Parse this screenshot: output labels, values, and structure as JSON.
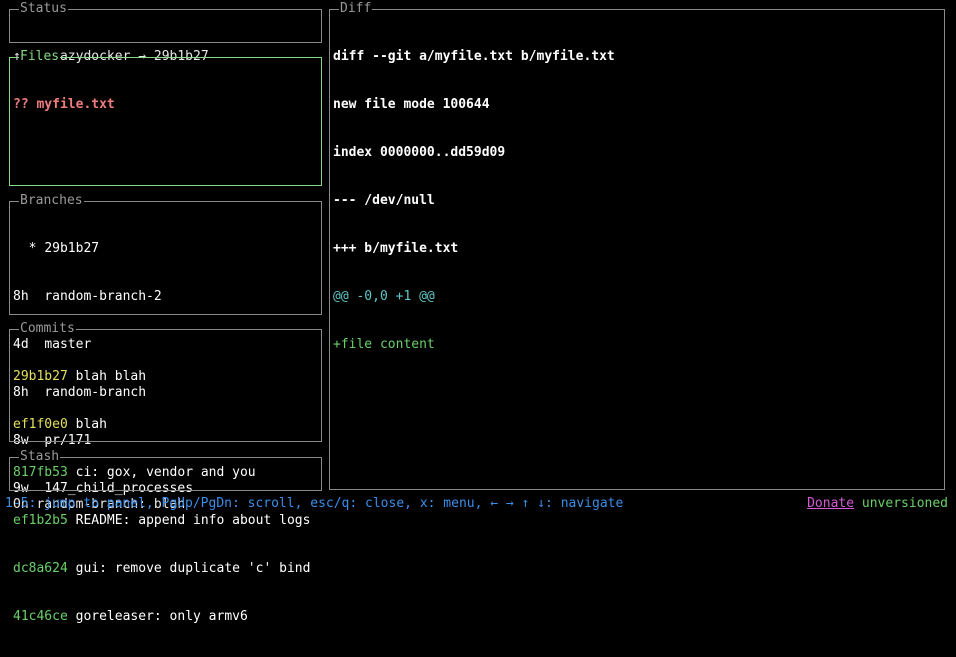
{
  "status": {
    "title": "Status",
    "text": "↑?↓? lazydocker → 29b1b27"
  },
  "files": {
    "title": "Files",
    "items": [
      {
        "text": "?? myfile.txt"
      }
    ]
  },
  "branches": {
    "title": "Branches",
    "items": [
      {
        "recency": "  *",
        "name": "29b1b27"
      },
      {
        "recency": "8h ",
        "name": "random-branch-2"
      },
      {
        "recency": "4d ",
        "name": "master"
      },
      {
        "recency": "8h ",
        "name": "random-branch"
      },
      {
        "recency": "8w ",
        "name": "pr/171"
      },
      {
        "recency": "9w ",
        "name": "147_child_processes"
      }
    ]
  },
  "commits": {
    "title": "Commits",
    "items": [
      {
        "sha": "29b1b27",
        "message": "blah blah",
        "sha_color": "#e5e05c"
      },
      {
        "sha": "ef1f0e0",
        "message": "blah",
        "sha_color": "#e5e05c"
      },
      {
        "sha": "817fb53",
        "message": "ci: gox, vendor and you",
        "sha_color": "#6ad06a"
      },
      {
        "sha": "ef1b2b5",
        "message": "README: append info about logs",
        "sha_color": "#6ad06a"
      },
      {
        "sha": "dc8a624",
        "message": "gui: remove duplicate 'c' bind",
        "sha_color": "#6ad06a"
      },
      {
        "sha": "41c46ce",
        "message": "goreleaser: only armv6",
        "sha_color": "#6ad06a"
      }
    ]
  },
  "stash": {
    "title": "Stash",
    "items": [
      {
        "text": "On random-branch: blah"
      }
    ]
  },
  "diff": {
    "title": "Diff",
    "lines": [
      {
        "text": "diff --git a/myfile.txt b/myfile.txt",
        "kind": "header"
      },
      {
        "text": "new file mode 100644",
        "kind": "header"
      },
      {
        "text": "index 0000000..dd59d09",
        "kind": "header"
      },
      {
        "text": "--- /dev/null",
        "kind": "header"
      },
      {
        "text": "+++ b/myfile.txt",
        "kind": "header"
      },
      {
        "text": "@@ -0,0 +1 @@",
        "kind": "hunk"
      },
      {
        "text": "+file content",
        "kind": "add"
      }
    ]
  },
  "footer": {
    "help": "1-5: jump to panel, PgUp/PgDn: scroll, esc/q: close, x: menu, ← → ↑ ↓: navigate",
    "donate": "Donate",
    "version": "unversioned"
  },
  "colors": {
    "active_border": "#86d986",
    "inactive_border": "#8a8a8a",
    "help_text": "#3b8ee8",
    "donate": "#d45ad4",
    "version": "#6ad06a"
  }
}
